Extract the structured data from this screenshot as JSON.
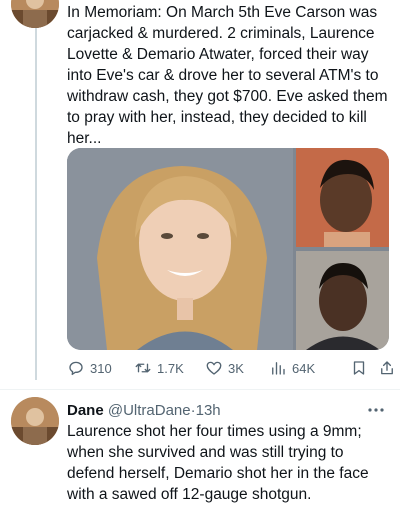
{
  "tweet": {
    "text": "In Memoriam: On March 5th Eve Carson was carjacked & murdered. 2 criminals, Laurence Lovette & Demario Atwater, forced their way into Eve's car & drove her to several ATM's to withdraw cash, they got $700. Eve asked them to pray with her, instead, they decided to kill her...",
    "replies": "310",
    "retweets": "1.7K",
    "likes": "3K",
    "views": "64K"
  },
  "reply": {
    "name": "Dane",
    "handle": "@UltraDane",
    "separator": "·",
    "time": "13h",
    "text": "Laurence shot her four times using a 9mm; when she survived and was still trying to defend herself, Demario shot her in the face with a sawed off 12-gauge shotgun."
  },
  "icons": {
    "reply": "speech-bubble-icon",
    "retweet": "retweet-arrows-icon",
    "like": "heart-icon",
    "views": "bar-chart-icon",
    "bookmark": "bookmark-icon",
    "share": "share-upload-icon",
    "more": "more-dots-icon"
  },
  "colors": {
    "text": "#0f1419",
    "secondary": "#536471",
    "thread_line": "#cfd9de"
  }
}
